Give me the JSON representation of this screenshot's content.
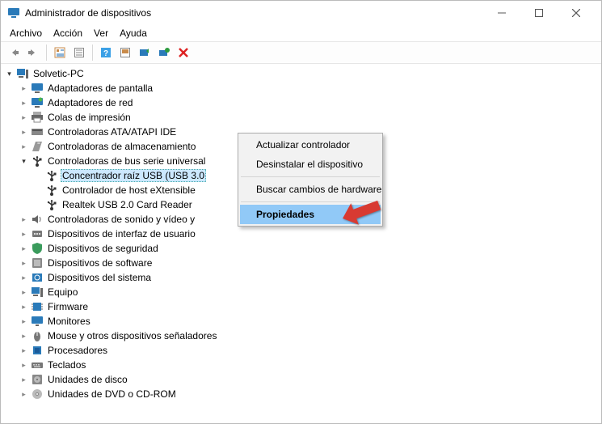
{
  "window": {
    "title": "Administrador de dispositivos"
  },
  "menubar": [
    "Archivo",
    "Acción",
    "Ver",
    "Ayuda"
  ],
  "tree": {
    "root": "Solvetic-PC",
    "categories": [
      {
        "label": "Adaptadores de pantalla",
        "icon": "monitor",
        "open": false
      },
      {
        "label": "Adaptadores de red",
        "icon": "net",
        "open": false
      },
      {
        "label": "Colas de impresión",
        "icon": "printer",
        "open": false
      },
      {
        "label": "Controladoras ATA/ATAPI IDE",
        "icon": "ide",
        "open": false
      },
      {
        "label": "Controladoras de almacenamiento",
        "icon": "storage",
        "open": false
      },
      {
        "label": "Controladoras de bus serie universal",
        "icon": "usb",
        "open": true,
        "children": [
          {
            "label": "Concentrador raíz USB (USB 3.0",
            "icon": "usb",
            "selected": true
          },
          {
            "label": "Controlador de host eXtensible",
            "icon": "usb"
          },
          {
            "label": "Realtek USB 2.0 Card Reader",
            "icon": "usb"
          }
        ]
      },
      {
        "label": "Controladoras de sonido y vídeo y",
        "icon": "sound",
        "open": false
      },
      {
        "label": "Dispositivos de interfaz de usuario",
        "icon": "hid",
        "open": false
      },
      {
        "label": "Dispositivos de seguridad",
        "icon": "shield",
        "open": false
      },
      {
        "label": "Dispositivos de software",
        "icon": "soft",
        "open": false
      },
      {
        "label": "Dispositivos del sistema",
        "icon": "sys",
        "open": false
      },
      {
        "label": "Equipo",
        "icon": "pc",
        "open": false
      },
      {
        "label": "Firmware",
        "icon": "chip",
        "open": false
      },
      {
        "label": "Monitores",
        "icon": "mon",
        "open": false
      },
      {
        "label": "Mouse y otros dispositivos señaladores",
        "icon": "mouse",
        "open": false
      },
      {
        "label": "Procesadores",
        "icon": "proc",
        "open": false
      },
      {
        "label": "Teclados",
        "icon": "key",
        "open": false
      },
      {
        "label": "Unidades de disco",
        "icon": "disk",
        "open": false
      },
      {
        "label": "Unidades de DVD o CD-ROM",
        "icon": "dvd",
        "open": false
      }
    ]
  },
  "context_menu": {
    "items": [
      {
        "label": "Actualizar controlador",
        "sep": false
      },
      {
        "label": "Desinstalar el dispositivo",
        "sep": true
      },
      {
        "label": "Buscar cambios de hardware",
        "sep": true
      },
      {
        "label": "Propiedades",
        "highlight": true
      }
    ]
  }
}
